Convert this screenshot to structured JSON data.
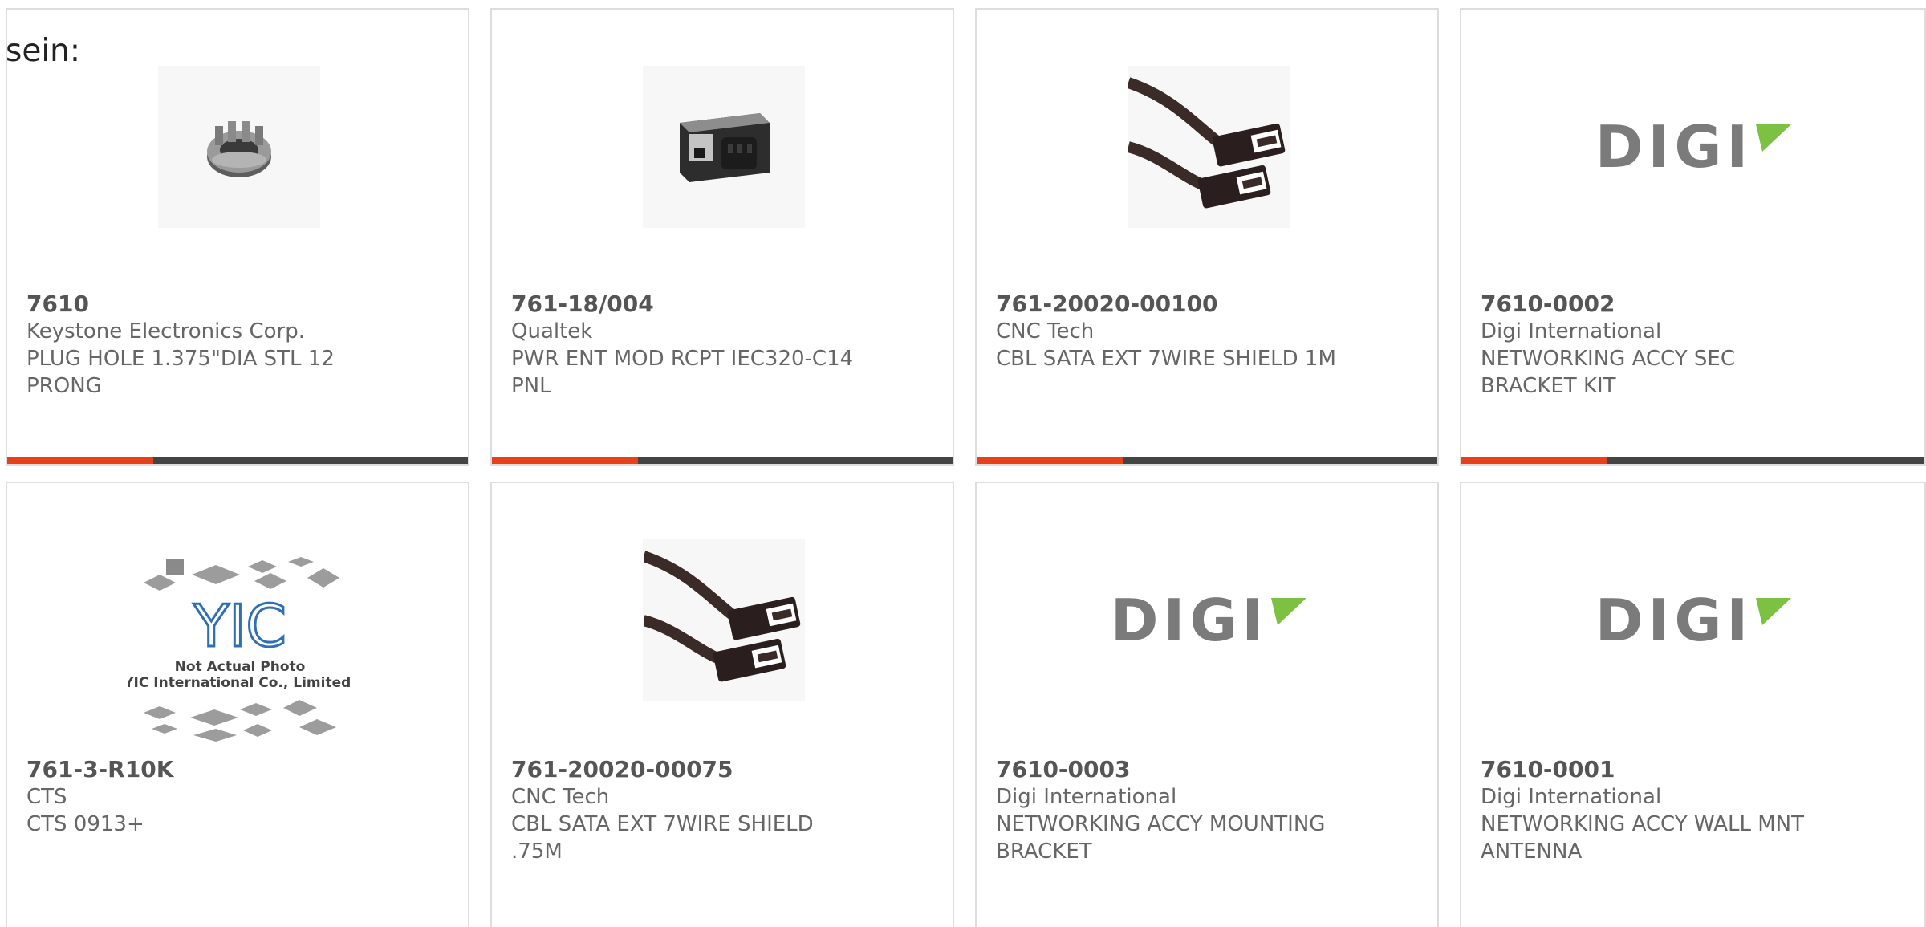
{
  "intro_text": "sein:",
  "colors": {
    "accent": "#e8411a",
    "bar": "#444444",
    "digi_green": "#7cc142"
  },
  "products": [
    {
      "part_number": "7610",
      "manufacturer": "Keystone Electronics Corp.",
      "description": "PLUG HOLE 1.375\"DIA STL 12\nPRONG",
      "image": "plug-hole-icon"
    },
    {
      "part_number": "761-18/004",
      "manufacturer": "Qualtek",
      "description": "PWR ENT MOD RCPT IEC320-C14\nPNL",
      "image": "power-entry-module-icon"
    },
    {
      "part_number": "761-20020-00100",
      "manufacturer": "CNC Tech",
      "description": "CBL SATA EXT 7WIRE SHIELD 1M",
      "image": "sata-cable-icon"
    },
    {
      "part_number": "7610-0002",
      "manufacturer": "Digi International",
      "description": "NETWORKING ACCY SEC\nBRACKET KIT",
      "image": "digi-logo"
    },
    {
      "part_number": "761-3-R10K",
      "manufacturer": "CTS",
      "description": "CTS 0913+",
      "image": "yic-placeholder-icon"
    },
    {
      "part_number": "761-20020-00075",
      "manufacturer": "CNC Tech",
      "description": "CBL SATA EXT 7WIRE SHIELD\n.75M",
      "image": "sata-cable-icon"
    },
    {
      "part_number": "7610-0003",
      "manufacturer": "Digi International",
      "description": "NETWORKING ACCY MOUNTING\nBRACKET",
      "image": "digi-logo"
    },
    {
      "part_number": "7610-0001",
      "manufacturer": "Digi International",
      "description": "NETWORKING ACCY WALL MNT\nANTENNA",
      "image": "digi-logo"
    }
  ],
  "digi_logo_text": "DIGI",
  "yic_placeholder": {
    "logo_text": "YIC",
    "line1": "Not Actual Photo",
    "line2": "YIC International Co., Limited."
  }
}
